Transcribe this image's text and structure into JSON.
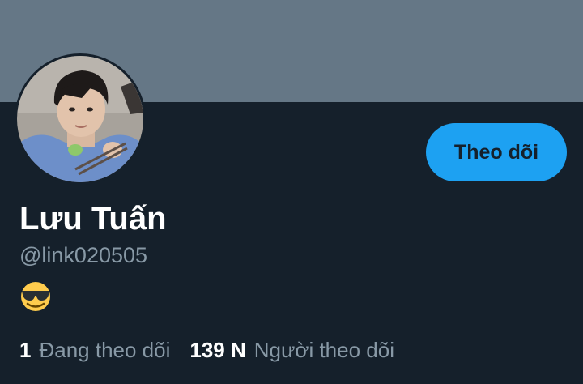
{
  "profile": {
    "display_name": "Lưu Tuấn",
    "handle": "@link020505",
    "bio_emoji": "smiling-face-with-sunglasses-icon",
    "follow_label": "Theo dõi",
    "avatar_icon": "profile-photo"
  },
  "stats": {
    "following_count": "1",
    "following_label": "Đang theo dõi",
    "followers_count": "139 N",
    "followers_label": "Người theo dõi"
  },
  "colors": {
    "background": "#15202b",
    "banner": "#657786",
    "accent": "#1da1f2",
    "secondary_text": "#8899a6",
    "emoji_yellow": "#ffcc4d"
  }
}
